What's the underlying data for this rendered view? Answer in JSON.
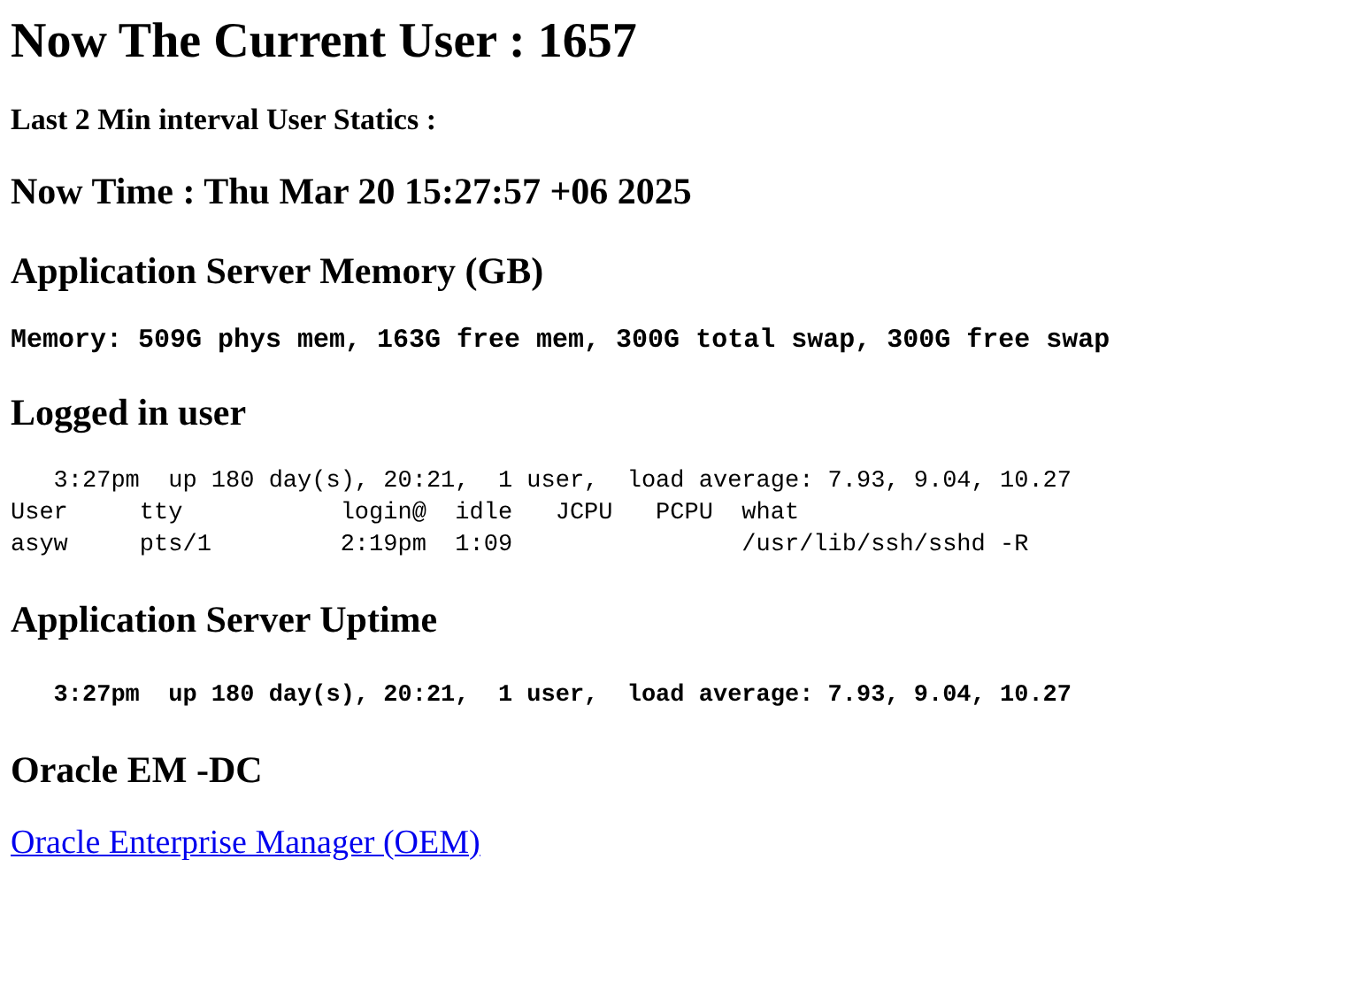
{
  "title": "Now The Current User : 1657",
  "interval_label": "Last 2 Min interval User Statics :",
  "now_time": "Now Time : Thu Mar 20 15:27:57 +06 2025",
  "sections": [
    {
      "heading": "Application Server Memory (GB)",
      "kind": "bold_text",
      "text": "Memory: 509G phys mem, 163G free mem, 300G total swap, 300G free swap"
    },
    {
      "heading": "Logged in user",
      "kind": "pre",
      "lines": [
        "   3:27pm  up 180 day(s), 20:21,  1 user,  load average: 7.93, 9.04, 10.27",
        "User     tty           login@  idle   JCPU   PCPU  what",
        "asyw     pts/1         2:19pm  1:09                /usr/lib/ssh/sshd -R"
      ]
    },
    {
      "heading": "Application Server Uptime",
      "kind": "bold_pre",
      "lines": [
        "   3:27pm  up 180 day(s), 20:21,  1 user,  load average: 7.93, 9.04, 10.27"
      ]
    },
    {
      "heading": "Oracle EM -DC",
      "kind": "link",
      "text": "Oracle Enterprise Manager (OEM)"
    }
  ]
}
